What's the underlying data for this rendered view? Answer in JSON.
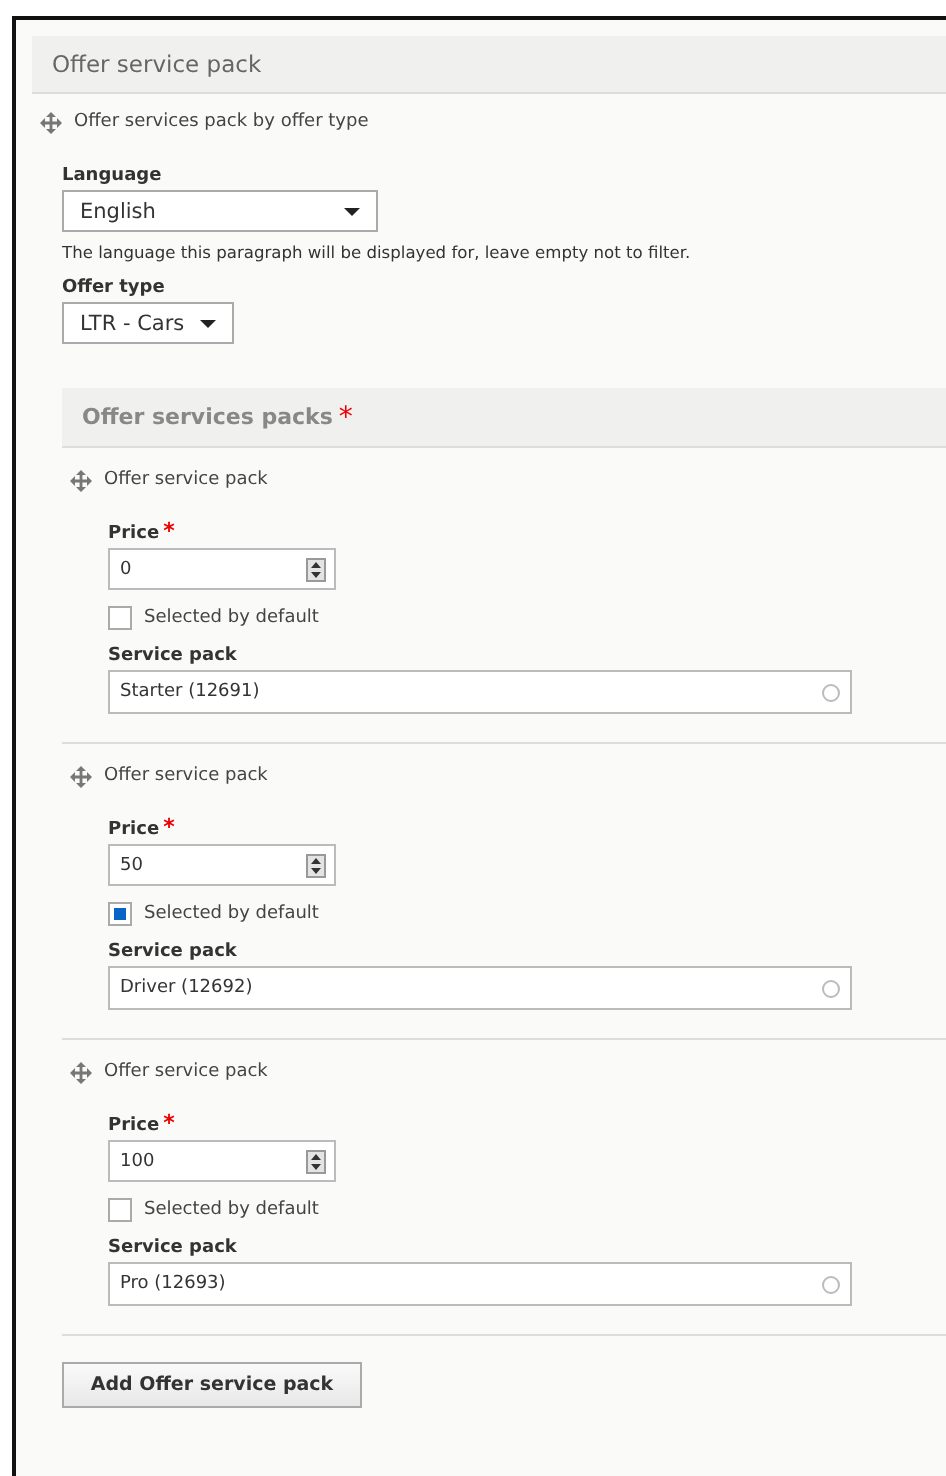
{
  "panel": {
    "title": "Offer service pack"
  },
  "paragraph": {
    "title": "Offer services pack by offer type",
    "language": {
      "label": "Language",
      "value": "English",
      "help": "The language this paragraph will be displayed for, leave empty not to filter."
    },
    "offer_type": {
      "label": "Offer type",
      "value": "LTR - Cars"
    }
  },
  "packs_section": {
    "title": "Offer services packs",
    "required_mark": "*",
    "items": [
      {
        "title": "Offer service pack",
        "price_label": "Price",
        "price_required": "*",
        "price": "0",
        "checkbox_label": "Selected by default",
        "checked": false,
        "service_label": "Service pack",
        "service": "Starter (12691)"
      },
      {
        "title": "Offer service pack",
        "price_label": "Price",
        "price_required": "*",
        "price": "50",
        "checkbox_label": "Selected by default",
        "checked": true,
        "service_label": "Service pack",
        "service": "Driver (12692)"
      },
      {
        "title": "Offer service pack",
        "price_label": "Price",
        "price_required": "*",
        "price": "100",
        "checkbox_label": "Selected by default",
        "checked": false,
        "service_label": "Service pack",
        "service": "Pro (12693)"
      }
    ],
    "add_button": "Add Offer service pack"
  }
}
